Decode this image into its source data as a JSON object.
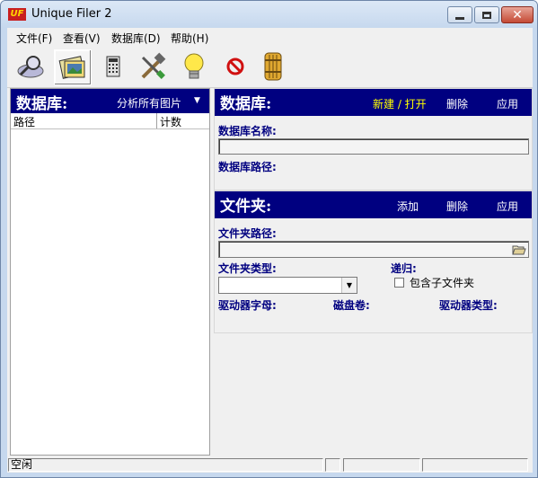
{
  "window": {
    "title": "Unique Filer 2",
    "app_icon_text": "UF"
  },
  "menu": {
    "items": [
      "文件(F)",
      "查看(V)",
      "数据库(D)",
      "帮助(H)"
    ]
  },
  "toolbar": {
    "tools": [
      "search-icon",
      "image-database-icon",
      "calculator-icon",
      "tools-icon",
      "lightbulb-icon",
      "stop-icon",
      "door-icon"
    ]
  },
  "left_pane": {
    "title": "数据库:",
    "analyze_label": "分析所有图片",
    "columns": [
      "路径",
      "计数"
    ]
  },
  "database_section": {
    "title": "数据库:",
    "actions": [
      "新建 / 打开",
      "删除",
      "应用"
    ],
    "name_label": "数据库名称:",
    "name_value": "",
    "path_label": "数据库路径:"
  },
  "folder_section": {
    "title": "文件夹:",
    "actions": [
      "添加",
      "删除",
      "应用"
    ],
    "path_label": "文件夹路径:",
    "path_value": "",
    "type_label": "文件夹类型:",
    "type_value": "",
    "recurse_label": "递归:",
    "include_subfolders_label": "包含子文件夹",
    "include_subfolders_checked": false,
    "drive_letter_label": "驱动器字母:",
    "volume_label": "磁盘卷:",
    "drive_type_label": "驱动器类型:"
  },
  "status": {
    "text": "空闲"
  },
  "colors": {
    "header_bg": "#000080",
    "header_text": "#ffffff",
    "accent_link": "#ffff00",
    "label": "#000080"
  }
}
